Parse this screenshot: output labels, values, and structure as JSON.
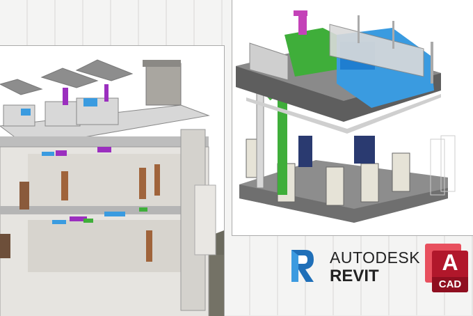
{
  "left_render": {
    "subject": "multi-storey building section"
  },
  "right_render": {
    "subject": "mechanical floor assembly"
  },
  "revit_logo": {
    "letter": "R",
    "brand": "AUTODESK",
    "product": "REVIT"
  },
  "autocad_logo": {
    "letter": "A",
    "label": "CAD"
  },
  "colors": {
    "revit_blue": "#1f6fb8",
    "autocad_red": "#b1172b",
    "duct_blue": "#3a9be0",
    "pipe_green": "#3fae3a",
    "purple": "#9b2fbf"
  }
}
